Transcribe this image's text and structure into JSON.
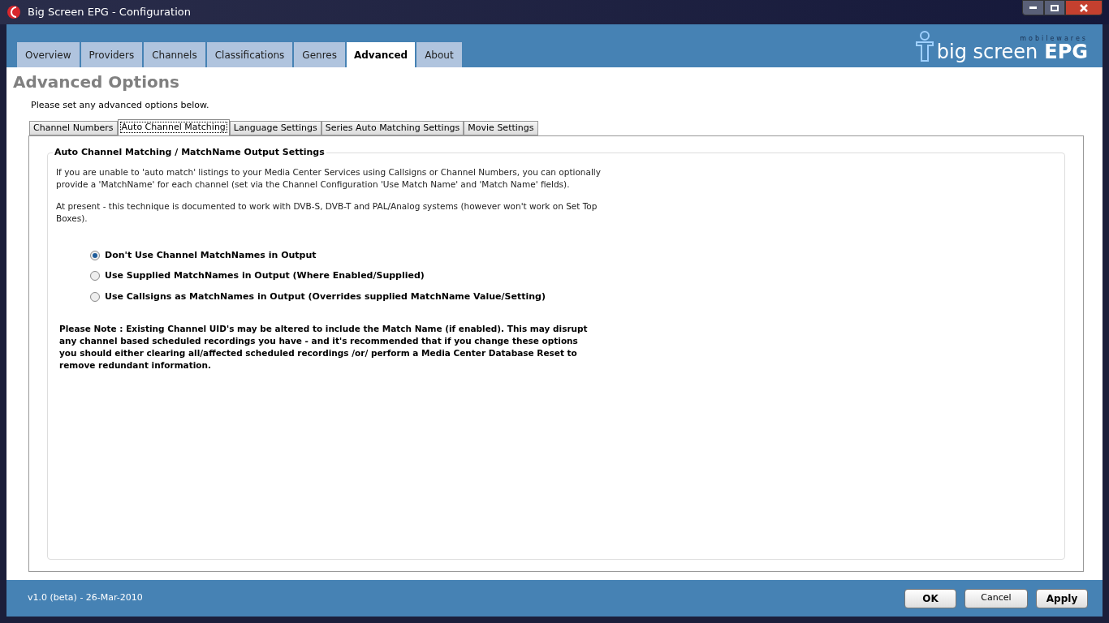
{
  "window": {
    "title": "Big Screen EPG - Configuration"
  },
  "logo": {
    "tagline": "mobilewares",
    "name": "big screen",
    "name_bold": "EPG"
  },
  "main_tabs": [
    {
      "label": "Overview",
      "selected": false
    },
    {
      "label": "Providers",
      "selected": false
    },
    {
      "label": "Channels",
      "selected": false
    },
    {
      "label": "Classifications",
      "selected": false
    },
    {
      "label": "Genres",
      "selected": false
    },
    {
      "label": "Advanced",
      "selected": true
    },
    {
      "label": "About",
      "selected": false
    }
  ],
  "page": {
    "heading": "Advanced Options",
    "intro": "Please set any advanced options below."
  },
  "sub_tabs": [
    {
      "label": "Channel Numbers",
      "selected": false
    },
    {
      "label": "Auto Channel Matching",
      "selected": true
    },
    {
      "label": "Language Settings",
      "selected": false
    },
    {
      "label": "Series Auto Matching Settings",
      "selected": false
    },
    {
      "label": "Movie Settings",
      "selected": false
    }
  ],
  "group": {
    "title": "Auto Channel Matching / MatchName Output Settings",
    "paragraphs": [
      "If you are unable to 'auto match' listings to your Media Center Services using Callsigns or Channel Numbers, you can optionally provide a 'MatchName' for each channel (set via the Channel Configuration 'Use Match Name' and 'Match Name' fields).",
      "At present - this technique is documented to work with DVB-S, DVB-T and PAL/Analog systems (however won't work on Set Top Boxes)."
    ],
    "options": [
      {
        "label": "Don't Use Channel MatchNames in Output",
        "selected": true
      },
      {
        "label": "Use Supplied MatchNames in Output (Where Enabled/Supplied)",
        "selected": false
      },
      {
        "label": "Use Callsigns as MatchNames in Output (Overrides supplied MatchName Value/Setting)",
        "selected": false
      }
    ],
    "note": "Please Note : Existing Channel UID's may be altered to include the Match Name (if enabled). This may disrupt any channel based scheduled recordings you have - and it's recommended that if you  change these options you should either clearing all/affected scheduled recordings /or/ perform a Media Center Database Reset to remove redundant information."
  },
  "status_bar": {
    "version": "v1.0 (beta) - 26-Mar-2010"
  },
  "buttons": [
    {
      "label": "OK",
      "bold": true
    },
    {
      "label": "Cancel",
      "bold": false
    },
    {
      "label": "Apply",
      "bold": true
    }
  ]
}
